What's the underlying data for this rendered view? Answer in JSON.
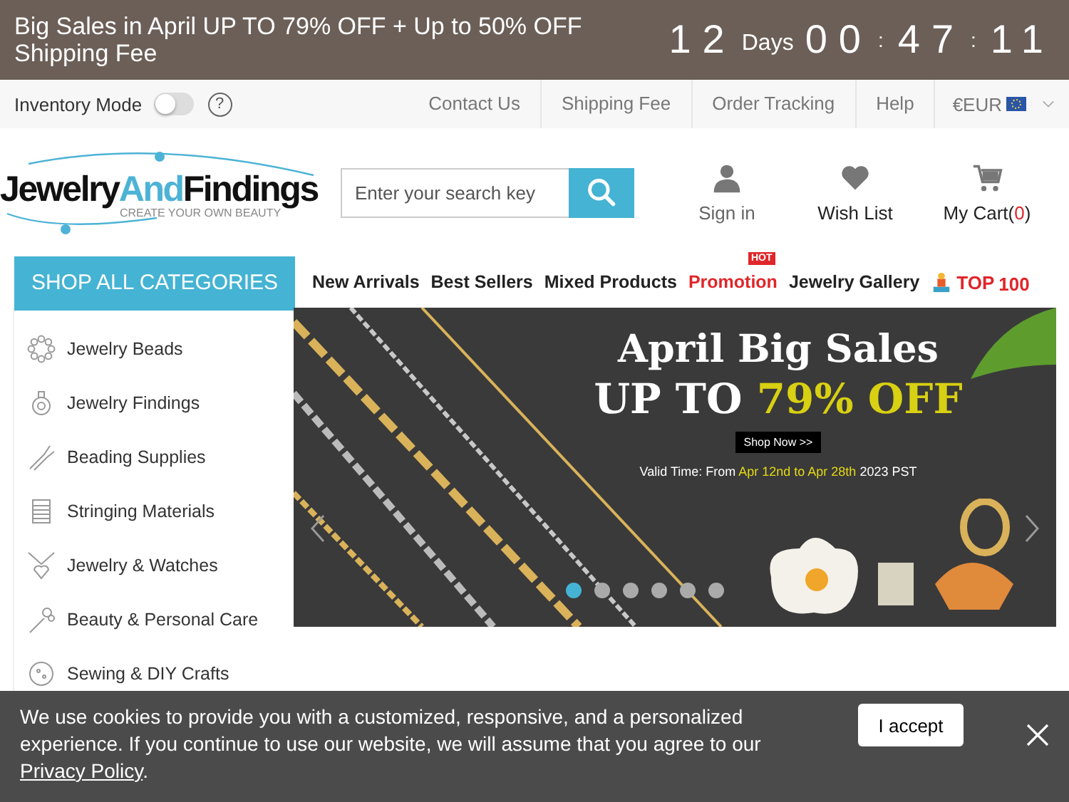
{
  "promo_bar": {
    "text": "Big Sales in April UP TO 79% OFF + Up to 50% OFF Shipping Fee",
    "countdown": {
      "days": "12",
      "days_label": "Days",
      "hours": "00",
      "minutes": "47",
      "seconds": "11",
      "separator": ":"
    }
  },
  "utility_bar": {
    "inventory_mode": {
      "label": "Inventory Mode",
      "on": false,
      "help": "?"
    },
    "links": [
      "Contact Us",
      "Shipping Fee",
      "Order Tracking",
      "Help"
    ],
    "currency": "€EUR"
  },
  "header": {
    "logo": {
      "name_part1": "Jewelry",
      "name_part2": "And",
      "name_part3": "Findings",
      "tagline": "CREATE YOUR OWN BEAUTY"
    },
    "search": {
      "placeholder": "Enter your search key"
    },
    "actions": [
      {
        "kind": "account",
        "label": "Sign in"
      },
      {
        "kind": "wishlist",
        "label": "Wish List"
      },
      {
        "kind": "cart",
        "label": "My Cart(",
        "count": "0",
        "suffix": ")"
      }
    ]
  },
  "nav": {
    "categories_button": "SHOP ALL CATEGORIES",
    "items": [
      {
        "kind": "plain",
        "label": "New Arrivals"
      },
      {
        "kind": "plain",
        "label": "Best Sellers"
      },
      {
        "kind": "plain",
        "label": "Mixed Products"
      },
      {
        "kind": "promo",
        "label": "Promotion",
        "badge": "HOT"
      },
      {
        "kind": "plain",
        "label": "Jewelry Gallery"
      },
      {
        "kind": "top",
        "label": "TOP",
        "number": "100"
      }
    ]
  },
  "sidebar": {
    "items": [
      "Jewelry Beads",
      "Jewelry Findings",
      "Beading Supplies",
      "Stringing Materials",
      "Jewelry & Watches",
      "Beauty & Personal Care",
      "Sewing & DIY Crafts"
    ]
  },
  "banner": {
    "title": "April Big Sales",
    "headline": "UP TO",
    "headline_highlight": "79% OFF",
    "button": "Shop Now >>",
    "valid_prefix": "Valid Time: From",
    "valid_dates": "Apr 12nd to Apr 28th",
    "valid_suffix": "2023 PST",
    "dots": [
      {
        "selected": true
      },
      {
        "selected": false
      },
      {
        "selected": false
      },
      {
        "selected": false
      },
      {
        "selected": false
      },
      {
        "selected": false
      }
    ]
  },
  "cookie_notice": {
    "text": "We use cookies to provide you with a customized, responsive, and a personalized experience. If you continue to use our website, we will assume that you agree to our",
    "link": "Privacy Policy",
    "end": ".",
    "button": "I accept"
  }
}
